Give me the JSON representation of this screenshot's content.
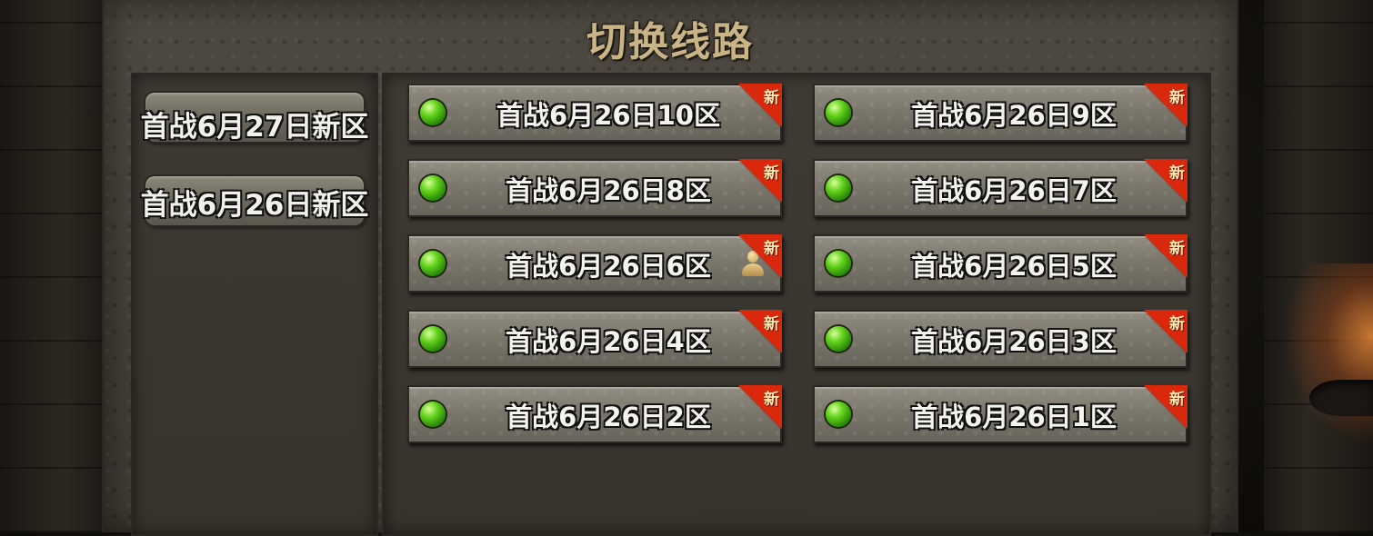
{
  "window": {
    "title": "切换线路"
  },
  "zone_groups": [
    {
      "label": "首战6月27日新区"
    },
    {
      "label": "首战6月26日新区"
    }
  ],
  "servers": [
    {
      "name": "首战6月26日10区",
      "badge": "新",
      "status": "online",
      "user_here": false
    },
    {
      "name": "首战6月26日9区",
      "badge": "新",
      "status": "online",
      "user_here": false
    },
    {
      "name": "首战6月26日8区",
      "badge": "新",
      "status": "online",
      "user_here": false
    },
    {
      "name": "首战6月26日7区",
      "badge": "新",
      "status": "online",
      "user_here": false
    },
    {
      "name": "首战6月26日6区",
      "badge": "新",
      "status": "online",
      "user_here": true
    },
    {
      "name": "首战6月26日5区",
      "badge": "新",
      "status": "online",
      "user_here": false
    },
    {
      "name": "首战6月26日4区",
      "badge": "新",
      "status": "online",
      "user_here": false
    },
    {
      "name": "首战6月26日3区",
      "badge": "新",
      "status": "online",
      "user_here": false
    },
    {
      "name": "首战6月26日2区",
      "badge": "新",
      "status": "online",
      "user_here": false
    },
    {
      "name": "首战6月26日1区",
      "badge": "新",
      "status": "online",
      "user_here": false
    }
  ],
  "colors": {
    "title": "#c9b486",
    "new_badge": "#d9280c",
    "status_online": "#62d11b",
    "stone": "#7b776c"
  },
  "icons": {
    "status": "green-orb-icon",
    "new": "new-corner-badge",
    "current_user": "user-icon"
  }
}
